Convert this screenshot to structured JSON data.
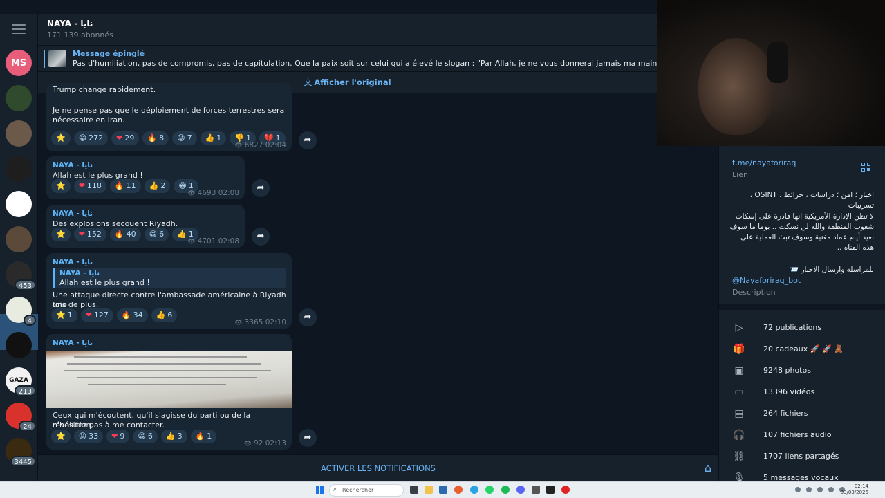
{
  "header": {
    "title": "NAYA - نايا",
    "subscribers": "171 139 abonnés"
  },
  "pinned": {
    "label": "Message épinglé",
    "text": "Pas d'humiliation, pas de compromis, pas de capitulation. Que la paix soit sur celui qui a élevé le slogan : \"Par Allah, je ne vous donnerai jamais ma main en signe de soumission\""
  },
  "translate": {
    "label": "Afficher l'original"
  },
  "sidebar": {
    "avatars": [
      {
        "initials": "MS",
        "color": "#e85d7a",
        "badge": ""
      },
      {
        "initials": "",
        "color": "#2f4a2c",
        "badge": ""
      },
      {
        "initials": "",
        "color": "#6b5a4a",
        "badge": ""
      },
      {
        "initials": "",
        "color": "#1e1e1e",
        "badge": ""
      },
      {
        "initials": "",
        "color": "#ffffff",
        "badge": ""
      },
      {
        "initials": "",
        "color": "#5b4a3a",
        "badge": ""
      },
      {
        "initials": "",
        "color": "#2a2a2a",
        "badge": "453"
      },
      {
        "initials": "",
        "color": "#e8ece0",
        "badge": "4"
      },
      {
        "initials": "",
        "color": "#111111",
        "badge": ""
      },
      {
        "initials": "GAZA",
        "color": "#f2f2f2",
        "badge": "213"
      },
      {
        "initials": "",
        "color": "#d9322c",
        "badge": "24"
      },
      {
        "initials": "",
        "color": "#3a2a10",
        "badge": "3445"
      }
    ]
  },
  "messages": [
    {
      "sender": "",
      "line0": "Trump change rapidement.",
      "text": [
        "Je ne pense pas que le déploiement de forces terrestres sera",
        "nécessaire en Iran."
      ],
      "reactions": [
        {
          "emoji": "⭐",
          "count": ""
        },
        {
          "emoji": "😁",
          "count": "272"
        },
        {
          "emoji": "❤",
          "count": "29"
        },
        {
          "emoji": "🔥",
          "count": "8"
        },
        {
          "emoji": "😡",
          "count": "7"
        },
        {
          "emoji": "👍",
          "count": "1"
        },
        {
          "emoji": "👎",
          "count": "1"
        },
        {
          "emoji": "💔",
          "count": "1"
        }
      ],
      "views": "6827",
      "time": "02:04"
    },
    {
      "sender": "NAYA - نايا",
      "text": [
        "Allah est le plus grand !"
      ],
      "reactions": [
        {
          "emoji": "⭐",
          "count": ""
        },
        {
          "emoji": "❤",
          "count": "118"
        },
        {
          "emoji": "🔥",
          "count": "11"
        },
        {
          "emoji": "👍",
          "count": "2"
        },
        {
          "emoji": "😁",
          "count": "1"
        }
      ],
      "views": "4693",
      "time": "02:08"
    },
    {
      "sender": "NAYA - نايا",
      "text": [
        "Des explosions secouent Riyadh."
      ],
      "reactions": [
        {
          "emoji": "⭐",
          "count": ""
        },
        {
          "emoji": "❤",
          "count": "152"
        },
        {
          "emoji": "🔥",
          "count": "40"
        },
        {
          "emoji": "😁",
          "count": "6"
        },
        {
          "emoji": "👍",
          "count": "1"
        }
      ],
      "views": "4701",
      "time": "02:08"
    },
    {
      "sender": "NAYA - نايا",
      "quote": {
        "name": "NAYA - نايا",
        "text": "Allah est le plus grand !"
      },
      "text": [
        "Une attaque directe contre l'ambassade américaine à Riyadh une",
        "fois de plus."
      ],
      "reactions": [
        {
          "emoji": "⭐",
          "count": "1"
        },
        {
          "emoji": "❤",
          "count": "127"
        },
        {
          "emoji": "🔥",
          "count": "34"
        },
        {
          "emoji": "👍",
          "count": "6"
        }
      ],
      "views": "3365",
      "time": "02:10"
    },
    {
      "sender": "NAYA - نايا",
      "text": [
        "Ceux qui m'écoutent, qu'il s'agisse du parti ou de la révolution,",
        "n'hésitez pas à me contacter."
      ],
      "reactions": [
        {
          "emoji": "⭐",
          "count": ""
        },
        {
          "emoji": "😡",
          "count": "33"
        },
        {
          "emoji": "❤",
          "count": "9"
        },
        {
          "emoji": "😁",
          "count": "6"
        },
        {
          "emoji": "👍",
          "count": "3"
        },
        {
          "emoji": "🔥",
          "count": "1"
        }
      ],
      "views": "92",
      "time": "02:13"
    }
  ],
  "bottom": {
    "notify_label": "ACTIVER LES NOTIFICATIONS"
  },
  "profile": {
    "link": "t.me/nayaforiraq",
    "link_label": "Lien",
    "bio_line1": "اخبار ؛ امن ؛ دراسات ، خرائط ، OSINT ، تسريبات",
    "bio_para": "لا تظن الإدارة الأمريكية انها قادرة على إسكات شعوب المنطقة والله لن نسكت .. يوما ما سوف نعيد أيام عماد مغنية وسوف تبث العملية على هذة القناة ..",
    "bio_contact": "للمراسلة وارسال الاخبار 📨",
    "bot": "@Nayaforiraq_bot",
    "desc_label": "Description",
    "stats": [
      {
        "icon": "publications-icon",
        "glyph": "▷",
        "label": "72 publications"
      },
      {
        "icon": "gift-icon",
        "glyph": "🎁",
        "label": "20 cadeaux 🚀 🚀 🧸"
      },
      {
        "icon": "photos-icon",
        "glyph": "▣",
        "label": "9248 photos"
      },
      {
        "icon": "videos-icon",
        "glyph": "▭",
        "label": "13396 vidéos"
      },
      {
        "icon": "files-icon",
        "glyph": "▤",
        "label": "264 fichiers"
      },
      {
        "icon": "audio-icon",
        "glyph": "🎧",
        "label": "107 fichiers audio"
      },
      {
        "icon": "links-icon",
        "glyph": "⛓",
        "label": "1707 liens partagés"
      },
      {
        "icon": "voice-icon",
        "glyph": "🎙",
        "label": "5 messages vocaux"
      }
    ]
  },
  "taskbar": {
    "search_placeholder": "Rechercher",
    "time": "02:14",
    "date": "03/03/2026"
  }
}
